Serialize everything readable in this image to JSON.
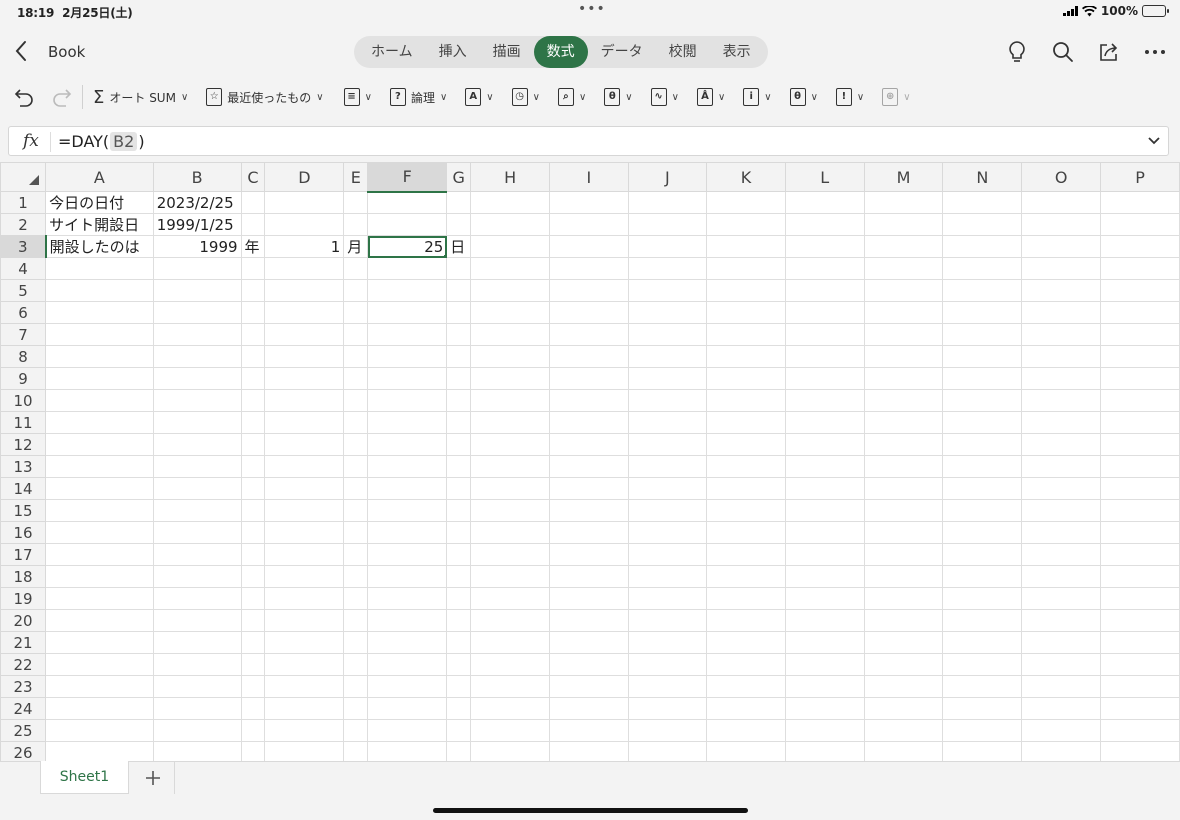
{
  "status_bar": {
    "time": "18:19",
    "date": "2月25日(土)",
    "battery": "100%"
  },
  "header": {
    "doc_title": "Book",
    "tabs": [
      {
        "label": "ホーム"
      },
      {
        "label": "挿入"
      },
      {
        "label": "描画"
      },
      {
        "label": "数式",
        "active": true
      },
      {
        "label": "データ"
      },
      {
        "label": "校閲"
      },
      {
        "label": "表示"
      }
    ]
  },
  "ribbon": {
    "autosum_label": "オート SUM",
    "recent_label": "最近使ったもの",
    "logic_label": "論理",
    "icons": [
      "financial",
      "logic",
      "text",
      "date-time",
      "lookup",
      "math",
      "statistical",
      "engineering",
      "info",
      "database",
      "compatibility",
      "web"
    ]
  },
  "formula_bar": {
    "prefix": "=DAY(",
    "ref": "B2",
    "suffix": ")"
  },
  "grid": {
    "columns": [
      "A",
      "B",
      "C",
      "D",
      "E",
      "F",
      "G",
      "H",
      "I",
      "J",
      "K",
      "L",
      "M",
      "N",
      "O",
      "P"
    ],
    "selected_column": "F",
    "selected_row": 3,
    "rows": [
      {
        "n": "1",
        "cells": {
          "A": "今日の日付",
          "B": "2023/2/25"
        }
      },
      {
        "n": "2",
        "cells": {
          "A": "サイト開設日",
          "B": "1999/1/25"
        }
      },
      {
        "n": "3",
        "cells": {
          "A": "開設したのは",
          "B": "1999",
          "C": "年",
          "D": "1",
          "E": "月",
          "F": "25",
          "G": "日"
        }
      },
      {
        "n": "4"
      },
      {
        "n": "5"
      },
      {
        "n": "6"
      },
      {
        "n": "7"
      },
      {
        "n": "8"
      },
      {
        "n": "9"
      },
      {
        "n": "10"
      },
      {
        "n": "11"
      },
      {
        "n": "12"
      },
      {
        "n": "13"
      },
      {
        "n": "14"
      },
      {
        "n": "15"
      },
      {
        "n": "16"
      },
      {
        "n": "17"
      },
      {
        "n": "18"
      },
      {
        "n": "19"
      },
      {
        "n": "20"
      },
      {
        "n": "21"
      },
      {
        "n": "22"
      },
      {
        "n": "23"
      },
      {
        "n": "24"
      },
      {
        "n": "25"
      },
      {
        "n": "26"
      }
    ]
  },
  "sheets": [
    {
      "label": "Sheet1",
      "active": true
    }
  ],
  "colors": {
    "accent": "#2e7447"
  }
}
